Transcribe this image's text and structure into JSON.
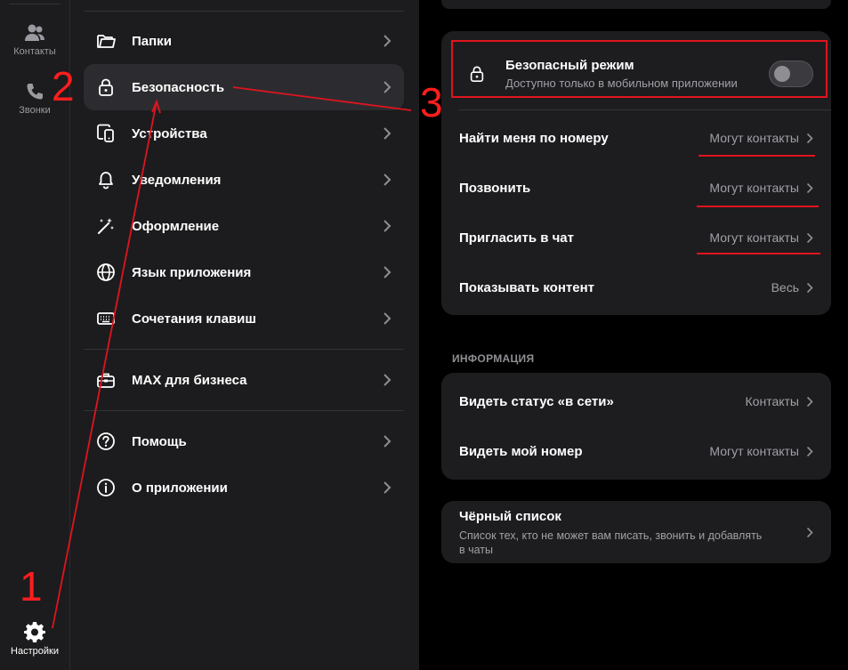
{
  "rail": {
    "contacts_label": "Контакты",
    "calls_label": "Звонки",
    "settings_label": "Настройки"
  },
  "menu": {
    "folders": "Папки",
    "security": "Безопасность",
    "devices": "Устройства",
    "notifications": "Уведомления",
    "appearance": "Оформление",
    "language": "Язык приложения",
    "shortcuts": "Сочетания клавиш",
    "business": "MAX для бизнеса",
    "help": "Помощь",
    "about": "О приложении"
  },
  "security": {
    "safe_mode_title": "Безопасный режим",
    "safe_mode_subtitle": "Доступно только в мобильном приложении",
    "safe_mode_enabled": false,
    "rows": [
      {
        "label": "Найти меня по номеру",
        "value": "Могут контакты"
      },
      {
        "label": "Позвонить",
        "value": "Могут контакты"
      },
      {
        "label": "Пригласить в чат",
        "value": "Могут контакты"
      },
      {
        "label": "Показывать контент",
        "value": "Весь"
      }
    ]
  },
  "info": {
    "section_title": "ИНФОРМАЦИЯ",
    "rows": [
      {
        "label": "Видеть статус «в сети»",
        "value": "Контакты"
      },
      {
        "label": "Видеть мой номер",
        "value": "Могут контакты"
      }
    ]
  },
  "blacklist": {
    "title": "Чёрный список",
    "description_line1": "Список тех, кто не может вам писать, звонить и добавлять",
    "description_line2": "в чаты"
  },
  "annotations": {
    "n1": "1",
    "n2": "2",
    "n3": "3",
    "color": "#e0141e"
  }
}
